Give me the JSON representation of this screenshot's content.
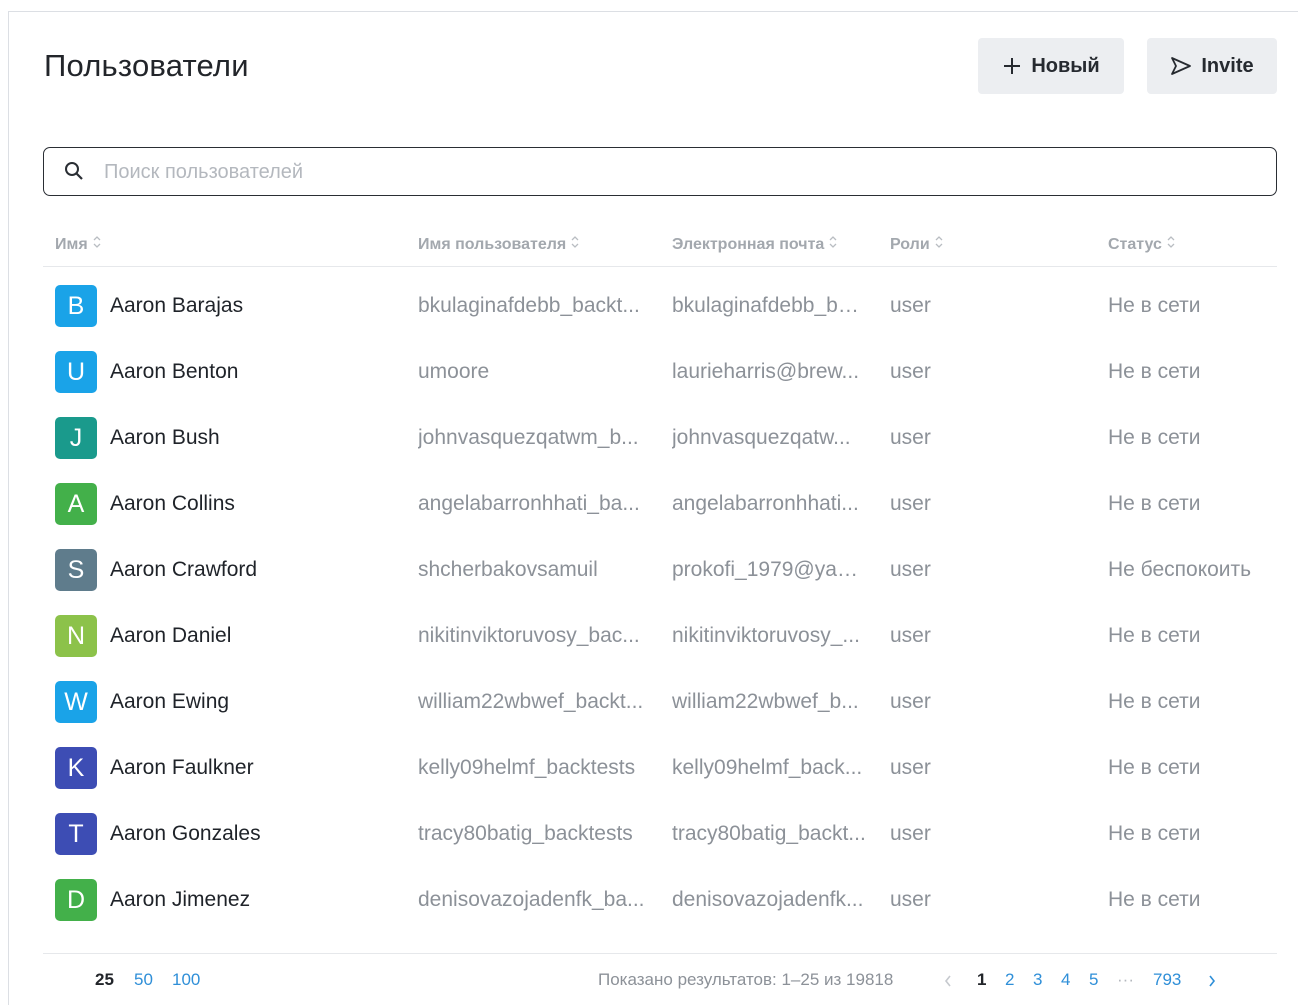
{
  "page": {
    "title": "Пользователи"
  },
  "toolbar": {
    "new_label": "Новый",
    "invite_label": "Invite"
  },
  "search": {
    "placeholder": "Поиск пользователей",
    "value": ""
  },
  "table": {
    "columns": [
      "Имя",
      "Имя пользователя",
      "Электронная почта",
      "Роли",
      "Статус"
    ],
    "rows": [
      {
        "initial": "B",
        "color": "#1aa3e8",
        "name": "Aaron Barajas",
        "username": "bkulaginafdebb_backt...",
        "email": "bkulaginafdebb_ba...",
        "role": "user",
        "status": "Не в сети"
      },
      {
        "initial": "U",
        "color": "#1aa3e8",
        "name": "Aaron Benton",
        "username": "umoore",
        "email": "laurieharris@brew...",
        "role": "user",
        "status": "Не в сети"
      },
      {
        "initial": "J",
        "color": "#1a9a8c",
        "name": "Aaron Bush",
        "username": "johnvasquezqatwm_b...",
        "email": "johnvasquezqatw...",
        "role": "user",
        "status": "Не в сети"
      },
      {
        "initial": "A",
        "color": "#43b04a",
        "name": "Aaron Collins",
        "username": "angelabarronhhati_ba...",
        "email": "angelabarronhhati...",
        "role": "user",
        "status": "Не в сети"
      },
      {
        "initial": "S",
        "color": "#5f7c8c",
        "name": "Aaron Crawford",
        "username": "shcherbakovsamuil",
        "email": "prokofi_1979@yan...",
        "role": "user",
        "status": "Не беспокоить"
      },
      {
        "initial": "N",
        "color": "#8cc24a",
        "name": "Aaron Daniel",
        "username": "nikitinviktoruvosy_bac...",
        "email": "nikitinviktoruvosy_...",
        "role": "user",
        "status": "Не в сети"
      },
      {
        "initial": "W",
        "color": "#1aa3e8",
        "name": "Aaron Ewing",
        "username": "william22wbwef_backt...",
        "email": "william22wbwef_b...",
        "role": "user",
        "status": "Не в сети"
      },
      {
        "initial": "K",
        "color": "#3d4db4",
        "name": "Aaron Faulkner",
        "username": "kelly09helmf_backtests",
        "email": "kelly09helmf_back...",
        "role": "user",
        "status": "Не в сети"
      },
      {
        "initial": "T",
        "color": "#3d4db4",
        "name": "Aaron Gonzales",
        "username": "tracy80batig_backtests",
        "email": "tracy80batig_backt...",
        "role": "user",
        "status": "Не в сети"
      },
      {
        "initial": "D",
        "color": "#43b04a",
        "name": "Aaron Jimenez",
        "username": "denisovazojadenfk_ba...",
        "email": "denisovazojadenfk...",
        "role": "user",
        "status": "Не в сети"
      }
    ]
  },
  "pagination": {
    "page_sizes": [
      "25",
      "50",
      "100"
    ],
    "active_size": "25",
    "summary": "Показано результатов: 1–25 из 19818",
    "pages": [
      "1",
      "2",
      "3",
      "4",
      "5"
    ],
    "ellipsis": "···",
    "last_page": "793",
    "current_page": "1"
  }
}
